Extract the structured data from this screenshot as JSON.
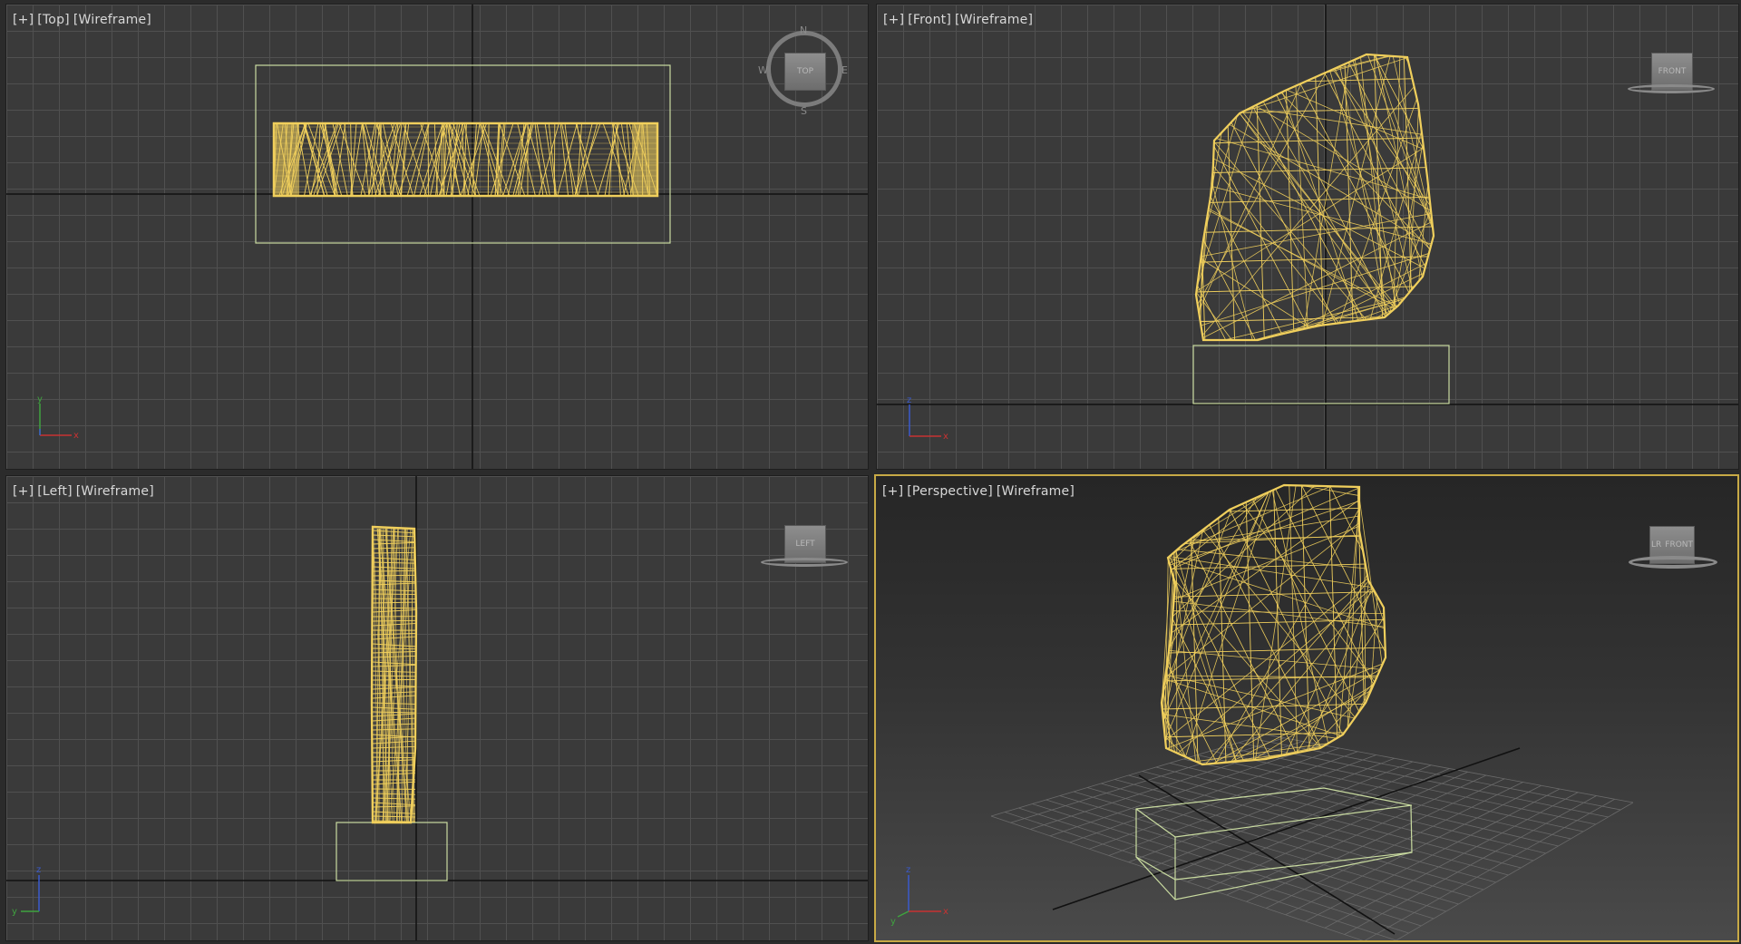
{
  "viewports": {
    "top": {
      "menu": "[+]",
      "view": "[Top]",
      "shading": "[Wireframe]",
      "cube_label": "TOP",
      "compass": [
        "N",
        "E",
        "S",
        "W"
      ],
      "axes": [
        "y",
        "x"
      ]
    },
    "front": {
      "menu": "[+]",
      "view": "[Front]",
      "shading": "[Wireframe]",
      "cube_label": "FRONT",
      "axes": [
        "z",
        "x"
      ]
    },
    "left": {
      "menu": "[+]",
      "view": "[Left]",
      "shading": "[Wireframe]",
      "cube_label": "LEFT",
      "axes": [
        "z",
        "y"
      ]
    },
    "perspective": {
      "menu": "[+]",
      "view": "[Perspective]",
      "shading": "[Wireframe]",
      "cube_label": "FRONT",
      "cube_side": "LR",
      "active": true,
      "axes": [
        "z",
        "x",
        "y"
      ]
    }
  },
  "colors": {
    "wireframe": "#f0cf5c",
    "selection_box": "#c9dba0",
    "grid": "#505050",
    "active_border": "#c8aa46"
  }
}
